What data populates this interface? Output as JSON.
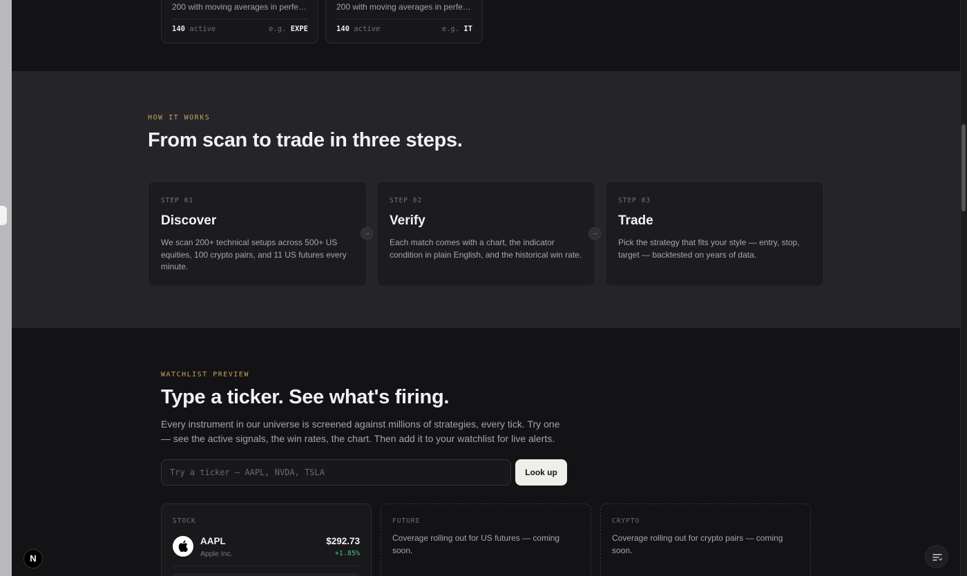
{
  "top_cards": [
    {
      "desc": "200 with moving averages in perfect...",
      "count": "140",
      "count_label": "active",
      "eg_prefix": "e.g.",
      "eg_symbol": "EXPE"
    },
    {
      "desc": "200 with moving averages in perfect...",
      "count": "140",
      "count_label": "active",
      "eg_prefix": "e.g.",
      "eg_symbol": "IT"
    }
  ],
  "how": {
    "eyebrow": "HOW IT WORKS",
    "title": "From scan to trade in three steps.",
    "steps": [
      {
        "label": "STEP 01",
        "title": "Discover",
        "text": "We scan 200+ technical setups across 500+ US equities, 100 crypto pairs, and 11 US futures every minute."
      },
      {
        "label": "STEP 02",
        "title": "Verify",
        "text": "Each match comes with a chart, the indicator condition in plain English, and the historical win rate."
      },
      {
        "label": "STEP 03",
        "title": "Trade",
        "text": "Pick the strategy that fits your style — entry, stop, target — backtested on years of data."
      }
    ],
    "arrow_glyph": "→"
  },
  "watch": {
    "eyebrow": "WATCHLIST PREVIEW",
    "title": "Type a ticker. See what's firing.",
    "desc": "Every instrument in our universe is screened against millions of strategies, every tick. Try one — see the active signals, the win rates, the chart. Then add it to your watchlist for live alerts.",
    "search_placeholder": "Try a ticker — AAPL, NVDA, TSLA",
    "search_value": "",
    "lookup_label": "Look up",
    "stock": {
      "type": "STOCK",
      "symbol": "AAPL",
      "name": "Apple Inc.",
      "price": "$292.73",
      "change": "+1.85%",
      "logo_icon": "apple-icon"
    },
    "future": {
      "type": "FUTURE",
      "msg": "Coverage rolling out for US futures — coming soon."
    },
    "crypto": {
      "type": "CRYPTO",
      "msg": "Coverage rolling out for crypto pairs — coming soon."
    }
  },
  "floating": {
    "next_badge": "N",
    "menu_icon": "list-filter-icon"
  },
  "colors": {
    "accent_eyebrow": "#c9a35c",
    "positive": "#46c37b",
    "button_bg": "#efefe9"
  }
}
